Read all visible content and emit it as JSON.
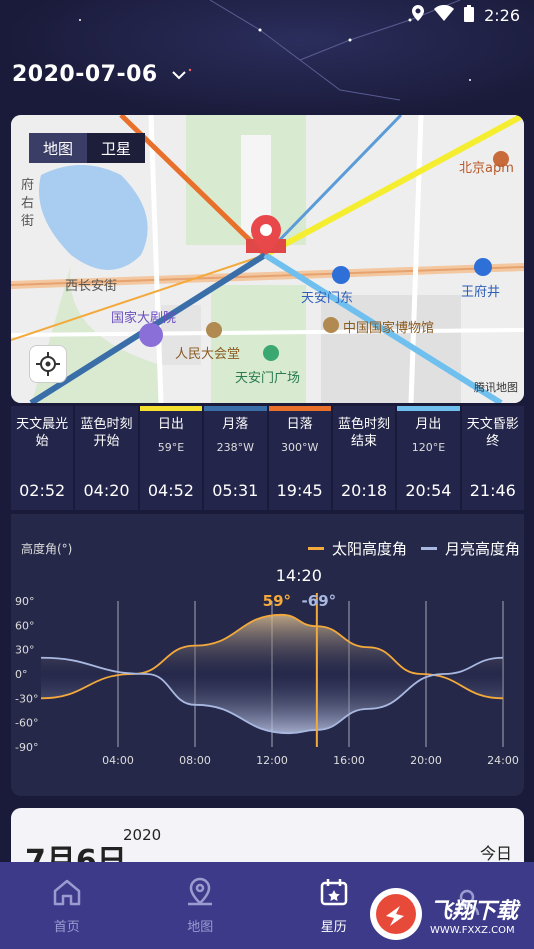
{
  "status_bar": {
    "time": "2:26"
  },
  "header": {
    "date": "2020-07-06"
  },
  "map": {
    "toggle": [
      "地图",
      "卫星"
    ],
    "labels": {
      "street1": "府右街",
      "street2": "西长安街",
      "theater": "国家大剧院",
      "hall": "人民大会堂",
      "gate": "天安门东",
      "square": "天安门广场",
      "museum": "中国国家博物馆",
      "wangfujing": "王府井",
      "apm": "北京apm"
    },
    "watermark": "腾讯地图"
  },
  "times": [
    {
      "name": "天文晨光始",
      "dir": "",
      "value": "02:52",
      "color": ""
    },
    {
      "name": "蓝色时刻开始",
      "dir": "",
      "value": "04:20",
      "color": ""
    },
    {
      "name": "日出",
      "dir": "59°E",
      "value": "04:52",
      "color": "#f5e030"
    },
    {
      "name": "月落",
      "dir": "238°W",
      "value": "05:31",
      "color": "#3a6ea8"
    },
    {
      "name": "日落",
      "dir": "300°W",
      "value": "19:45",
      "color": "#e8702a"
    },
    {
      "name": "蓝色时刻结束",
      "dir": "",
      "value": "20:18",
      "color": ""
    },
    {
      "name": "月出",
      "dir": "120°E",
      "value": "20:54",
      "color": "#6fc0ee"
    },
    {
      "name": "天文昏影终",
      "dir": "",
      "value": "21:46",
      "color": ""
    }
  ],
  "altitude_chart": {
    "title": "高度角(°)",
    "legend": [
      {
        "name": "太阳高度角",
        "color": "#f3a93b"
      },
      {
        "name": "月亮高度角",
        "color": "#a9b8e0"
      }
    ],
    "cursor_time": "14:20",
    "sun_value": "59°",
    "moon_value": "-69°"
  },
  "chart_data": {
    "type": "line",
    "xlabel": "",
    "ylabel": "高度角(°)",
    "x_ticks": [
      "04:00",
      "08:00",
      "12:00",
      "16:00",
      "20:00",
      "24:00"
    ],
    "y_ticks": [
      "90°",
      "60°",
      "30°",
      "0°",
      "-30°",
      "-60°",
      "-90°"
    ],
    "ylim": [
      -90,
      90
    ],
    "xlim": [
      0,
      24
    ],
    "series": [
      {
        "name": "太阳高度角",
        "x": [
          0,
          4.8,
          8,
          12.5,
          14.3,
          17,
          19.75,
          24
        ],
        "y": [
          -30,
          0,
          35,
          73,
          59,
          33,
          0,
          -30
        ]
      },
      {
        "name": "月亮高度角",
        "x": [
          0,
          5.5,
          8,
          12.9,
          14.3,
          17,
          20.9,
          24
        ],
        "y": [
          20,
          0,
          -38,
          -73,
          -69,
          -43,
          0,
          20
        ]
      }
    ]
  },
  "bottom_card": {
    "big_date": "7月6日",
    "year": "2020",
    "today": "今日"
  },
  "tabbar": [
    {
      "label": "首页",
      "icon": "home-icon",
      "active": false
    },
    {
      "label": "地图",
      "icon": "map-pin-icon",
      "active": false
    },
    {
      "label": "星历",
      "icon": "calendar-icon",
      "active": true
    },
    {
      "label": "",
      "icon": "profile-icon",
      "active": false
    }
  ],
  "logo_text": "飞翔下载",
  "logo_url": "WWW.FXXZ.COM"
}
